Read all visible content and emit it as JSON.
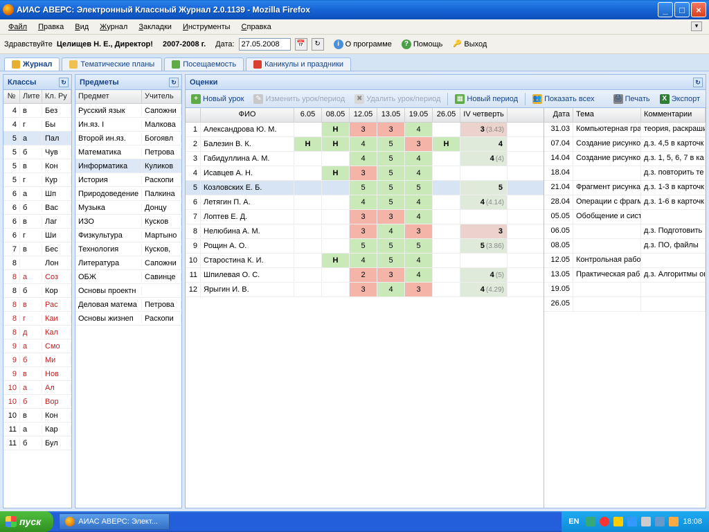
{
  "window": {
    "title": "АИАС АВЕРС: Электронный Классный Журнал 2.0.1139 - Mozilla Firefox"
  },
  "menu": {
    "file": "Файл",
    "edit": "Правка",
    "view": "Вид",
    "journal": "Журнал",
    "bookmarks": "Закладки",
    "tools": "Инструменты",
    "help": "Справка"
  },
  "infobar": {
    "greeting": "Здравствуйте",
    "user": "Целищев Н. Е., Директор!",
    "year": "2007-2008 г.",
    "date_label": "Дата:",
    "date_value": "27.05.2008",
    "about": "О программе",
    "help": "Помощь",
    "exit": "Выход"
  },
  "tabs": {
    "journal": "Журнал",
    "plans": "Тематические планы",
    "attendance": "Посещаемость",
    "holidays": "Каникулы и праздники"
  },
  "panels": {
    "classes": "Классы",
    "subjects": "Предметы",
    "grades": "Оценки"
  },
  "classes_cols": {
    "c0": "№",
    "c1": "Лите",
    "c2": "Кл. Ру"
  },
  "classes": [
    {
      "n": "4",
      "l": "в",
      "t": "Без"
    },
    {
      "n": "4",
      "l": "г",
      "t": "Бы"
    },
    {
      "n": "5",
      "l": "а",
      "t": "Пал",
      "sel": true
    },
    {
      "n": "5",
      "l": "б",
      "t": "Чув"
    },
    {
      "n": "5",
      "l": "в",
      "t": "Кон"
    },
    {
      "n": "5",
      "l": "г",
      "t": "Кур"
    },
    {
      "n": "6",
      "l": "а",
      "t": "Шп"
    },
    {
      "n": "6",
      "l": "б",
      "t": "Вас"
    },
    {
      "n": "6",
      "l": "в",
      "t": "Лаг"
    },
    {
      "n": "6",
      "l": "г",
      "t": "Ши"
    },
    {
      "n": "7",
      "l": "в",
      "t": "Бес"
    },
    {
      "n": "8",
      "l": "",
      "t": "Лон"
    },
    {
      "n": "8",
      "l": "а",
      "t": "Соз",
      "red": true
    },
    {
      "n": "8",
      "l": "б",
      "t": "Кор"
    },
    {
      "n": "8",
      "l": "в",
      "t": "Рас",
      "red": true
    },
    {
      "n": "8",
      "l": "г",
      "t": "Каи",
      "red": true
    },
    {
      "n": "8",
      "l": "д",
      "t": "Кал",
      "red": true
    },
    {
      "n": "9",
      "l": "а",
      "t": "Смо",
      "red": true
    },
    {
      "n": "9",
      "l": "б",
      "t": "Ми",
      "red": true
    },
    {
      "n": "9",
      "l": "в",
      "t": "Нов",
      "red": true
    },
    {
      "n": "10",
      "l": "а",
      "t": "Ал",
      "red": true
    },
    {
      "n": "10",
      "l": "б",
      "t": "Вор",
      "red": true
    },
    {
      "n": "10",
      "l": "в",
      "t": "Кон"
    },
    {
      "n": "11",
      "l": "а",
      "t": "Кар"
    },
    {
      "n": "11",
      "l": "б",
      "t": "Бул"
    }
  ],
  "subjects_cols": {
    "c0": "Предмет",
    "c1": "Учитель"
  },
  "subjects": [
    {
      "s": "Русский язык",
      "t": "Сапожни"
    },
    {
      "s": "Ин.яз. I",
      "t": "Малкова"
    },
    {
      "s": "Второй ин.яз.",
      "t": "Богоявл"
    },
    {
      "s": "Математика",
      "t": "Петрова"
    },
    {
      "s": "Информатика",
      "t": "Куликов",
      "sel": true
    },
    {
      "s": "История",
      "t": "Раскопи"
    },
    {
      "s": "Природоведение",
      "t": "Палкина"
    },
    {
      "s": "Музыка",
      "t": "Донцу"
    },
    {
      "s": "ИЗО",
      "t": "Кусков"
    },
    {
      "s": "Физкультура",
      "t": "Мартыно"
    },
    {
      "s": "Технология",
      "t": "Кусков,"
    },
    {
      "s": "Литература",
      "t": "Сапожни"
    },
    {
      "s": "ОБЖ",
      "t": "Савинце"
    },
    {
      "s": "Основы проектн",
      "t": ""
    },
    {
      "s": "Деловая матема",
      "t": "Петрова"
    },
    {
      "s": "Основы жизнеп",
      "t": "Раскопи"
    }
  ],
  "toolbar": {
    "new_lesson": "Новый урок",
    "edit": "Изменить урок/период",
    "del": "Удалить урок/период",
    "new_period": "Новый период",
    "show_all": "Показать всех",
    "print": "Печать",
    "export": "Экспорт"
  },
  "grades_cols": {
    "fio": "ФИО",
    "d1": "6.05",
    "d2": "08.05",
    "d3": "12.05",
    "d4": "13.05",
    "d5": "19.05",
    "d6": "26.05",
    "q": "IV четверть"
  },
  "grades": [
    {
      "n": "1",
      "name": "Александрова Ю. М.",
      "c": [
        "",
        "Н",
        "3",
        "3",
        "4",
        ""
      ],
      "q": "3",
      "qa": "(3.43)"
    },
    {
      "n": "2",
      "name": "Балезин В. К.",
      "c": [
        "Н",
        "Н",
        "4",
        "5",
        "3",
        "Н"
      ],
      "q": "4",
      "qa": ""
    },
    {
      "n": "3",
      "name": "Габидуллина А. М.",
      "c": [
        "",
        "",
        "4",
        "5",
        "4",
        ""
      ],
      "q": "4",
      "qa": "(4)"
    },
    {
      "n": "4",
      "name": "Исавцев А. Н.",
      "c": [
        "",
        "Н",
        "3",
        "5",
        "4",
        ""
      ],
      "q": "",
      "qa": ""
    },
    {
      "n": "5",
      "name": "Козловских Е. Б.",
      "c": [
        "",
        "",
        "5",
        "5",
        "5",
        ""
      ],
      "q": "5",
      "qa": "",
      "sel": true
    },
    {
      "n": "6",
      "name": "Летягин П. А.",
      "c": [
        "",
        "",
        "4",
        "5",
        "4",
        ""
      ],
      "q": "4",
      "qa": "(4.14)"
    },
    {
      "n": "7",
      "name": "Лоптев Е. Д.",
      "c": [
        "",
        "",
        "3",
        "3",
        "4",
        ""
      ],
      "q": "",
      "qa": ""
    },
    {
      "n": "8",
      "name": "Нелюбина А. М.",
      "c": [
        "",
        "",
        "3",
        "4",
        "3",
        ""
      ],
      "q": "3",
      "qa": ""
    },
    {
      "n": "9",
      "name": "Рощин А. О.",
      "c": [
        "",
        "",
        "5",
        "5",
        "5",
        ""
      ],
      "q": "5",
      "qa": "(3.86)"
    },
    {
      "n": "10",
      "name": "Старостина К. И.",
      "c": [
        "",
        "Н",
        "4",
        "5",
        "4",
        ""
      ],
      "q": "",
      "qa": ""
    },
    {
      "n": "11",
      "name": "Шпилевая О. С.",
      "c": [
        "",
        "",
        "2",
        "3",
        "4",
        ""
      ],
      "q": "4",
      "qa": "(5)"
    },
    {
      "n": "12",
      "name": "Ярыгин И. В.",
      "c": [
        "",
        "",
        "3",
        "4",
        "3",
        ""
      ],
      "q": "4",
      "qa": "(4.29)"
    }
  ],
  "diary_cols": {
    "date": "Дата",
    "topic": "Тема",
    "comm": "Комментарии"
  },
  "diary": [
    {
      "d": "31.03",
      "t": "Компьютерная гра",
      "c": "теория, раскраши"
    },
    {
      "d": "07.04",
      "t": "Создание рисунко",
      "c": "д.з. 4,5 в карточк"
    },
    {
      "d": "14.04",
      "t": "Создание рисунко",
      "c": "д.з. 1, 5, 6, 7 в ка"
    },
    {
      "d": "18.04",
      "t": "",
      "c": "д.з. повторить те"
    },
    {
      "d": "21.04",
      "t": "Фрагмент рисунка",
      "c": "д.з. 1-3 в карточк"
    },
    {
      "d": "28.04",
      "t": "Операции с фрагм",
      "c": "д.з. 1-6 в карточк"
    },
    {
      "d": "05.05",
      "t": "Обобщение и сист",
      "c": ""
    },
    {
      "d": "06.05",
      "t": "",
      "c": "д.з. Подготовить"
    },
    {
      "d": "08.05",
      "t": "",
      "c": "д.з. ПО, файлы"
    },
    {
      "d": "12.05",
      "t": "Контрольная рабо",
      "c": ""
    },
    {
      "d": "13.05",
      "t": "Практическая раб",
      "c": "д.з. Алгоритмы оп"
    },
    {
      "d": "19.05",
      "t": "",
      "c": ""
    },
    {
      "d": "26.05",
      "t": "",
      "c": ""
    }
  ],
  "taskbar": {
    "start": "пуск",
    "app": "АИАС АВЕРС: Элект...",
    "lang": "EN",
    "clock": "18:08"
  }
}
